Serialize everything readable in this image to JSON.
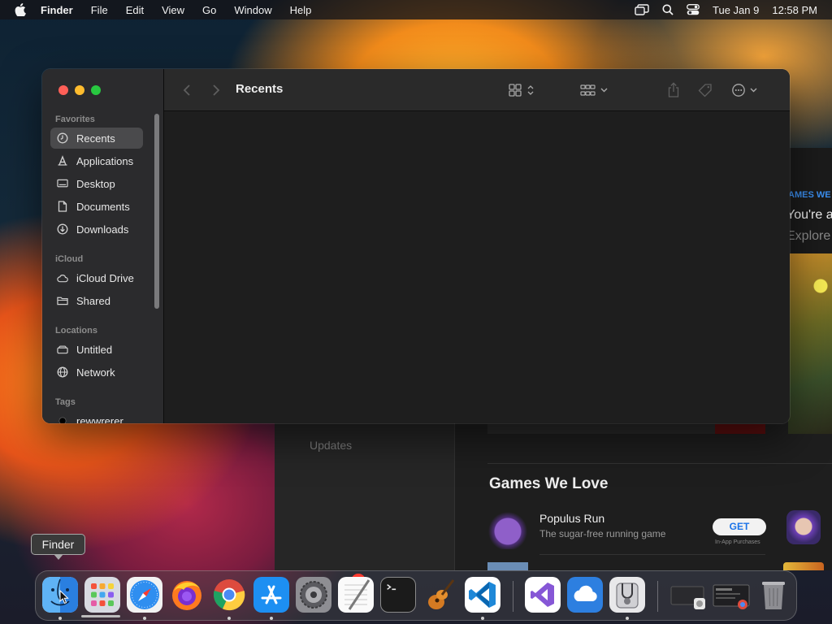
{
  "menubar": {
    "app_name": "Finder",
    "items": [
      "File",
      "Edit",
      "View",
      "Go",
      "Window",
      "Help"
    ],
    "date": "Tue Jan 9",
    "time": "12:58 PM"
  },
  "finder": {
    "title": "Recents",
    "sidebar": {
      "favorites_header": "Favorites",
      "favorites": [
        {
          "label": "Recents",
          "icon": "clock-icon",
          "selected": true
        },
        {
          "label": "Applications",
          "icon": "applications-icon"
        },
        {
          "label": "Desktop",
          "icon": "desktop-icon"
        },
        {
          "label": "Documents",
          "icon": "document-icon"
        },
        {
          "label": "Downloads",
          "icon": "download-icon"
        }
      ],
      "icloud_header": "iCloud",
      "icloud": [
        {
          "label": "iCloud Drive",
          "icon": "cloud-icon"
        },
        {
          "label": "Shared",
          "icon": "shared-folder-icon"
        }
      ],
      "locations_header": "Locations",
      "locations": [
        {
          "label": "Untitled",
          "icon": "drive-icon"
        },
        {
          "label": "Network",
          "icon": "globe-icon"
        }
      ],
      "tags_header": "Tags",
      "tags": [
        {
          "label": "rewwrerer",
          "color": "#000000"
        }
      ]
    }
  },
  "appstore_bg": {
    "updates_label": "Updates",
    "hero_kicker": "AMES WE",
    "hero_title": "You're a",
    "hero_subtitle": "Explore",
    "section_title": "Games We Love",
    "game": {
      "name": "Populus Run",
      "subtitle": "The sugar-free running game",
      "button": "GET",
      "note": "In-App Purchases"
    }
  },
  "dock": {
    "tooltip": "Finder",
    "badge_count": "1",
    "apps": [
      "Finder",
      "Launchpad",
      "Safari",
      "Firefox",
      "Chrome",
      "App Store",
      "System Settings",
      "TextEdit",
      "Terminal",
      "GarageBand",
      "Visual Studio Code",
      "Visual Studio",
      "iCloud",
      "Disk Utility",
      "Screenshot",
      "Screenshot",
      "Trash"
    ]
  }
}
